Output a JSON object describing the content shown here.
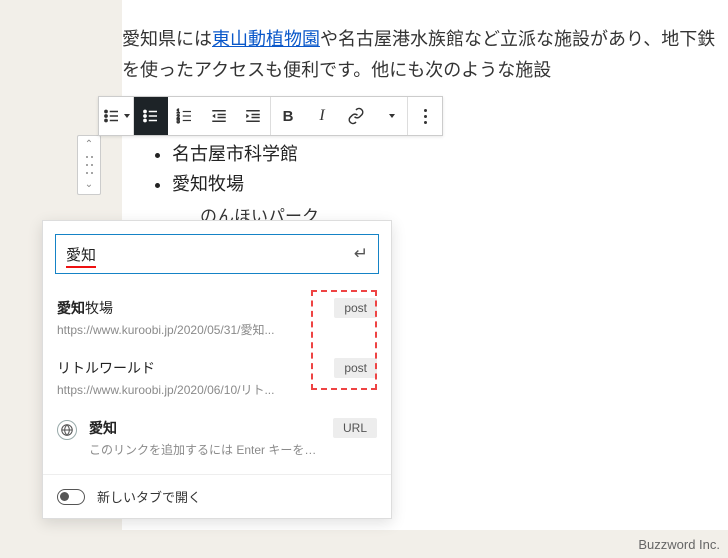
{
  "editor": {
    "paragraph_prefix": "愛知県には",
    "paragraph_link": "東山動植物園",
    "paragraph_suffix": "や名古屋港水族館など立派な施設があり、地下鉄を使ったアクセスも便利です。他にも次のような施設"
  },
  "toolbar": {
    "bold": "B",
    "italic": "I"
  },
  "list_items": [
    "名古屋市科学館",
    "愛知牧場"
  ],
  "list_partial": "のんほいパーク",
  "link_popover": {
    "search_value": "愛知",
    "results": [
      {
        "title_hl": "愛知",
        "title_rest": "牧場",
        "url": "https://www.kuroobi.jp/2020/05/31/愛知...",
        "badge": "post"
      },
      {
        "title_hl": "",
        "title_rest": "リトルワールド",
        "url": "https://www.kuroobi.jp/2020/06/10/リト...",
        "badge": "post"
      }
    ],
    "direct": {
      "title": "愛知",
      "hint": "このリンクを追加するには Enter キーを押...",
      "badge": "URL"
    },
    "new_tab_label": "新しいタブで開く"
  },
  "footer_credit": "Buzzword Inc."
}
